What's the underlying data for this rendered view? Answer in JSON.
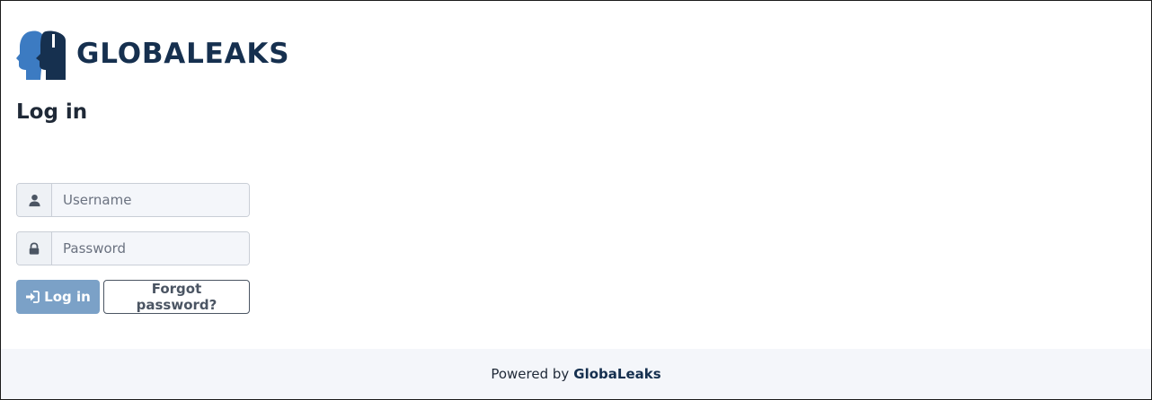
{
  "brand": {
    "name": "GLOBALEAKS",
    "logo_icon": "globaleaks-logo-icon",
    "colors": {
      "dark": "#16304f",
      "light": "#3c7bc2"
    }
  },
  "page": {
    "title": "Log in"
  },
  "form": {
    "username": {
      "placeholder": "Username",
      "value": "",
      "icon": "user-icon"
    },
    "password": {
      "placeholder": "Password",
      "value": "",
      "icon": "lock-icon"
    },
    "login_button": {
      "label": "Log in",
      "icon": "sign-in-icon",
      "color": "#7ba1c7"
    },
    "forgot_password_button": {
      "label": "Forgot password?"
    }
  },
  "footer": {
    "prefix": "Powered by",
    "link_text": "GlobaLeaks"
  }
}
